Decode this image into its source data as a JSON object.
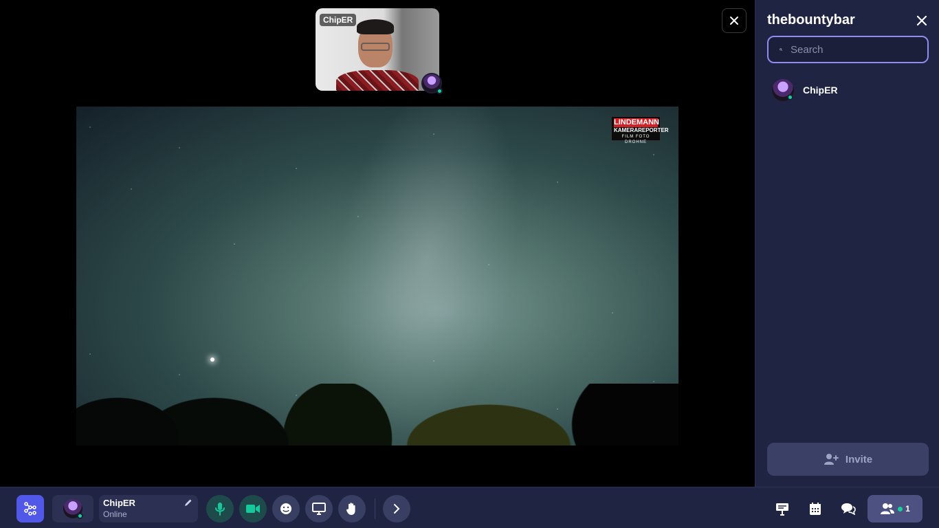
{
  "stage": {
    "participant_label": "ChipER",
    "watermark": {
      "line1": "LINDEMANN",
      "line2": "KAMERAREPORTER",
      "line3": "FILM FOTO DROHNE"
    }
  },
  "panel": {
    "title": "thebountybar",
    "search": {
      "placeholder": "Search",
      "value": ""
    },
    "members": [
      {
        "name": "ChipER",
        "status": "online"
      }
    ],
    "invite_label": "Invite"
  },
  "bottombar": {
    "user": {
      "name": "ChipER",
      "status": "Online"
    },
    "member_count": "1"
  },
  "colors": {
    "accent": "#5157e6",
    "online": "#15d19a",
    "panel_bg": "#1f2442",
    "control_green": "#15c99a"
  },
  "icons": [
    "close-icon",
    "search-icon",
    "user-plus-icon",
    "app-logo-icon",
    "pencil-icon",
    "microphone-icon",
    "camera-icon",
    "emoji-icon",
    "screen-share-icon",
    "raise-hand-icon",
    "chevron-right-icon",
    "board-icon",
    "calendar-icon",
    "chat-icon",
    "people-icon"
  ]
}
